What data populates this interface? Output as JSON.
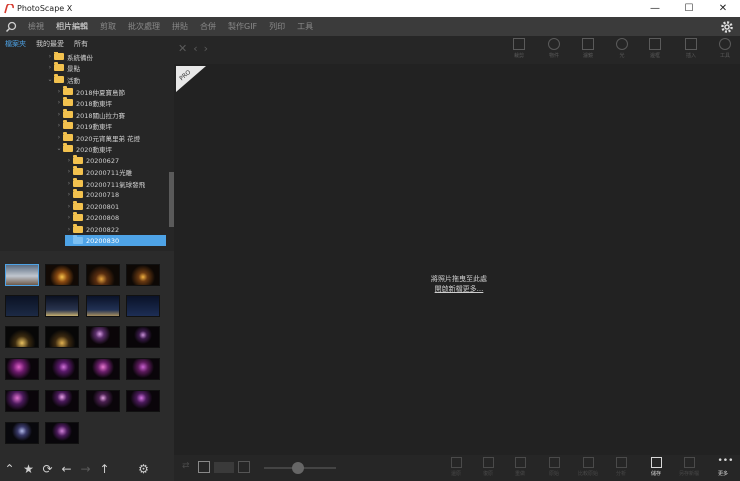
{
  "window": {
    "title": "PhotoScape X",
    "minimize": "—",
    "maximize": "☐",
    "close": "✕"
  },
  "tabs": [
    {
      "label": "檢視",
      "active": false
    },
    {
      "label": "相片編輯",
      "active": true
    },
    {
      "label": "剪取",
      "active": false
    },
    {
      "label": "批次處理",
      "active": false
    },
    {
      "label": "拼貼",
      "active": false
    },
    {
      "label": "合併",
      "active": false
    },
    {
      "label": "製作GIF",
      "active": false
    },
    {
      "label": "列印",
      "active": false
    },
    {
      "label": "工具",
      "active": false
    }
  ],
  "left": {
    "subtabs": [
      {
        "label": "檔案夾",
        "active": true
      },
      {
        "label": "我的最愛",
        "active": false
      },
      {
        "label": "所有",
        "active": false
      }
    ],
    "tree": [
      {
        "label": "系統備份",
        "depth": 1,
        "expanded": false
      },
      {
        "label": "景點",
        "depth": 1,
        "expanded": false
      },
      {
        "label": "活動",
        "depth": 1,
        "expanded": true
      },
      {
        "label": "2018仲夏寶島節",
        "depth": 2,
        "expanded": false
      },
      {
        "label": "2018動東坪",
        "depth": 2,
        "expanded": false
      },
      {
        "label": "2018關山拉力賽",
        "depth": 2,
        "expanded": false
      },
      {
        "label": "2019動東坪",
        "depth": 2,
        "expanded": false
      },
      {
        "label": "2020元宵萬里弟 花燈",
        "depth": 2,
        "expanded": false
      },
      {
        "label": "2020動東坪",
        "depth": 2,
        "expanded": true
      },
      {
        "label": "20200627",
        "depth": 3,
        "expanded": false
      },
      {
        "label": "20200711光雕",
        "depth": 3,
        "expanded": false
      },
      {
        "label": "20200711氣球發飛",
        "depth": 3,
        "expanded": false
      },
      {
        "label": "20200718",
        "depth": 3,
        "expanded": false
      },
      {
        "label": "20200801",
        "depth": 3,
        "expanded": false
      },
      {
        "label": "20200808",
        "depth": 3,
        "expanded": false
      },
      {
        "label": "20200822",
        "depth": 3,
        "expanded": false
      },
      {
        "label": "20200830",
        "depth": 3,
        "expanded": false,
        "selected": true
      }
    ]
  },
  "main": {
    "pro_badge": "PRO",
    "drop_text": "將照片拖曳至此處",
    "drop_link": "開啟新檔更多...",
    "toolbar": [
      {
        "label": "裁剪",
        "icon": "crop-icon"
      },
      {
        "label": "物件",
        "icon": "object-icon"
      },
      {
        "label": "濾鏡",
        "icon": "filter-icon"
      },
      {
        "label": "光",
        "icon": "light-icon"
      },
      {
        "label": "邊框",
        "icon": "frame-icon"
      },
      {
        "label": "插入",
        "icon": "insert-icon"
      },
      {
        "label": "工具",
        "icon": "tools-icon"
      }
    ]
  },
  "bottom": {
    "tools": [
      {
        "label": "還原",
        "enabled": false
      },
      {
        "label": "復原",
        "enabled": false
      },
      {
        "label": "重做",
        "enabled": false
      },
      {
        "label": "原始",
        "enabled": false
      },
      {
        "label": "比較原始",
        "enabled": false
      },
      {
        "label": "分析",
        "enabled": false
      },
      {
        "label": "儲存",
        "enabled": true
      },
      {
        "label": "另存新檔",
        "enabled": false
      },
      {
        "label": "更多",
        "enabled": true
      }
    ]
  }
}
